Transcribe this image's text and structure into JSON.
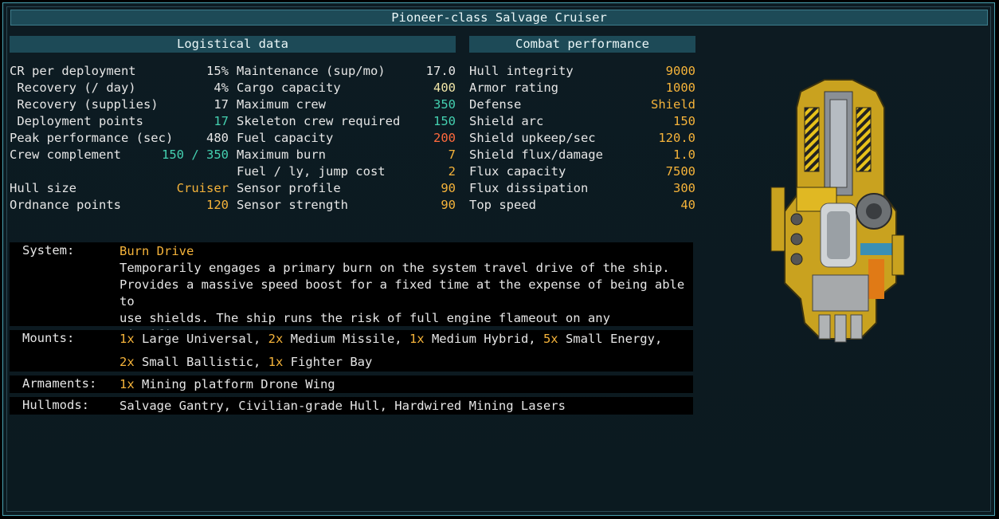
{
  "title": "Pioneer-class Salvage Cruiser",
  "sections": {
    "logistical": "Logistical data",
    "combat": "Combat performance"
  },
  "col1": [
    {
      "label": "CR per deployment",
      "value": "15%",
      "color": "white"
    },
    {
      "label": " Recovery (/ day)",
      "value": "4%",
      "color": "white"
    },
    {
      "label": " Recovery (supplies)",
      "value": "17",
      "color": "white"
    },
    {
      "label": " Deployment points",
      "value": "17",
      "color": "teal"
    },
    {
      "label": "Peak performance (sec)",
      "value": "480",
      "color": "white"
    },
    {
      "label": "Crew complement",
      "value": "150 / 350",
      "color": "teal"
    },
    {
      "label": "",
      "value": "",
      "color": "white"
    },
    {
      "label": "Hull size",
      "value": "Cruiser",
      "color": "orange"
    },
    {
      "label": "Ordnance points",
      "value": "120",
      "color": "orange"
    }
  ],
  "col2": [
    {
      "label": "Maintenance (sup/mo)",
      "value": "17.0",
      "color": "white"
    },
    {
      "label": "Cargo capacity",
      "value": "400",
      "color": "pale"
    },
    {
      "label": "Maximum crew",
      "value": "350",
      "color": "teal"
    },
    {
      "label": "Skeleton crew required",
      "value": "150",
      "color": "teal"
    },
    {
      "label": "Fuel capacity",
      "value": "200",
      "color": "red"
    },
    {
      "label": "Maximum burn",
      "value": "7",
      "color": "orange"
    },
    {
      "label": "Fuel / ly, jump cost",
      "value": "2",
      "color": "orange"
    },
    {
      "label": "Sensor profile",
      "value": "90",
      "color": "orange"
    },
    {
      "label": "Sensor strength",
      "value": "90",
      "color": "orange"
    }
  ],
  "col3": [
    {
      "label": "Hull integrity",
      "value": "9000",
      "color": "orange"
    },
    {
      "label": "Armor rating",
      "value": "1000",
      "color": "orange"
    },
    {
      "label": "Defense",
      "value": "Shield",
      "color": "orange"
    },
    {
      "label": "Shield arc",
      "value": "150",
      "color": "orange"
    },
    {
      "label": "Shield upkeep/sec",
      "value": "120.0",
      "color": "orange"
    },
    {
      "label": "Shield flux/damage",
      "value": "1.0",
      "color": "orange"
    },
    {
      "label": "Flux capacity",
      "value": "7500",
      "color": "orange"
    },
    {
      "label": "Flux dissipation",
      "value": "300",
      "color": "orange"
    },
    {
      "label": "Top speed",
      "value": "40",
      "color": "orange"
    }
  ],
  "system": {
    "label": "System:",
    "name": "Burn Drive",
    "description": "Temporarily engages a primary burn on the system travel drive of the ship.\nProvides a massive speed boost for a fixed time at the expense of being able to\nuse shields. The ship runs the risk of full engine flameout on any significant\ncollision."
  },
  "mounts": {
    "label": "Mounts:",
    "line1": [
      {
        "count": "1x",
        "text": " Large Universal, "
      },
      {
        "count": "2x",
        "text": " Medium Missile, "
      },
      {
        "count": "1x",
        "text": " Medium Hybrid, "
      },
      {
        "count": "5x",
        "text": " Small Energy,"
      }
    ],
    "line2": [
      {
        "count": "2x",
        "text": " Small Ballistic, "
      },
      {
        "count": "1x",
        "text": " Fighter Bay"
      }
    ]
  },
  "armaments": {
    "label": "Armaments:",
    "items": [
      {
        "count": "1x",
        "text": " Mining platform Drone Wing"
      }
    ]
  },
  "hullmods": {
    "label": "Hullmods:",
    "text": "Salvage Gantry, Civilian-grade Hull, Hardwired Mining Lasers"
  },
  "colors": {
    "accent": "#f5b33a",
    "teal": "#44d0b0",
    "red": "#ff6a3d",
    "bar": "#1d4a57"
  },
  "ship_icon": "ship-sprite"
}
